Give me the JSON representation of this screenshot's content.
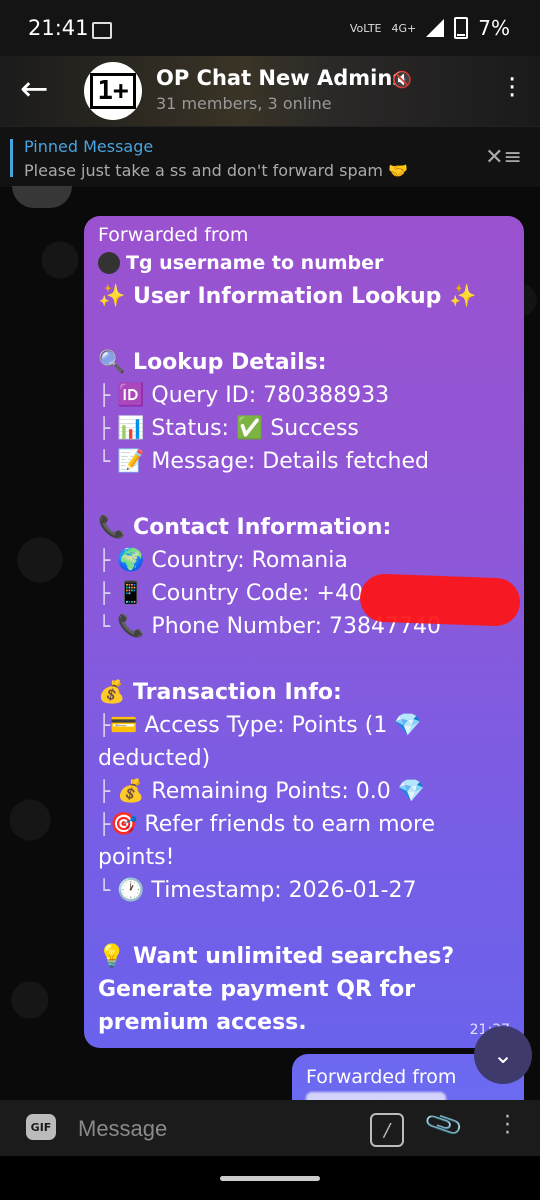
{
  "status_bar": {
    "time": "21:41",
    "network_small": "VoLTE",
    "network": "4G+",
    "battery": "7%"
  },
  "header": {
    "title": "OP Chat New Admins",
    "subtitle": "31 members, 3 online",
    "avatar_text": "1+"
  },
  "pinned": {
    "title": "Pinned Message",
    "text": "Please just take a ss and don't forward spam 🤝"
  },
  "message": {
    "forwarded_label": "Forwarded from",
    "forwarded_source": "Tg username to number",
    "heading": "✨ User Information Lookup ✨",
    "lookup_title": "🔍 Lookup Details:",
    "lookup_lines": [
      "🆔 Query ID: 780388933",
      "📊 Status: ✅ Success",
      "📝 Message: Details fetched"
    ],
    "contact_title": "📞 Contact Information:",
    "contact_lines": [
      "🌍 Country: Romania",
      "📱 Country Code: +40",
      "📞 Phone Number: 73847740"
    ],
    "transaction_title": "💰 Transaction Info:",
    "transaction_line1": "💳 Access Type: Points (1 💎",
    "transaction_line1_wrap": "deducted)",
    "transaction_line2": "💰 Remaining Points: 0.0 💎",
    "transaction_line3": "🎯 Refer friends to earn more",
    "transaction_line3_wrap": "points!",
    "transaction_line4": "🕐 Timestamp: 2026-01-27",
    "promo": "💡 Want unlimited searches? Generate payment QR for premium access.",
    "time": "21:37"
  },
  "message2": {
    "forwarded_label": "Forwarded from"
  },
  "input": {
    "gif_label": "GIF",
    "placeholder": "Message"
  }
}
